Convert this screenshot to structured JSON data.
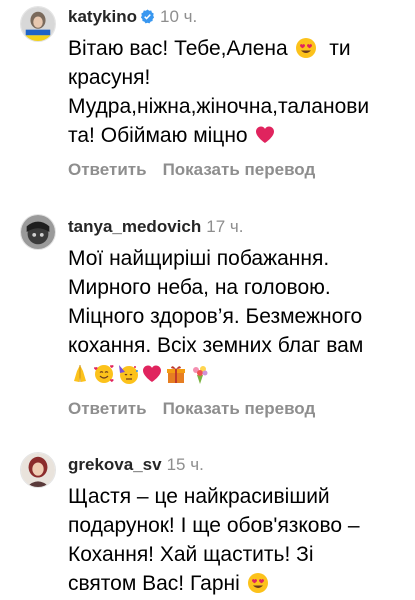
{
  "comments": [
    {
      "username": "katykino",
      "verified": true,
      "time": "10 ч.",
      "lines": [
        "Вітаю вас! Тебе,Алена",
        "красуня!",
        "Мудра,ніжна,жіночна,таланови",
        "та! Обіймаю міцно"
      ],
      "line1_tail": "ти",
      "reply_label": "Ответить",
      "translate_label": "Показать перевод"
    },
    {
      "username": "tanya_medovich",
      "verified": false,
      "time": "17 ч.",
      "lines": [
        "Мої найщиріші побажання.",
        "Мирного неба, на головою.",
        "Міцного здоров’я. Безмежного",
        "кохання. Всіх земних благ вам"
      ],
      "reply_label": "Ответить",
      "translate_label": "Показать перевод"
    },
    {
      "username": "grekova_sv",
      "verified": false,
      "time": "15 ч.",
      "lines": [
        "Щастя – це найкрасивіший",
        "подарунок! І ще обов'язково –",
        "Кохання! Хай щастить! Зі",
        "святом Вас! Гарні"
      ]
    }
  ],
  "icons": {
    "verified": "verified-badge-icon",
    "heart_eyes": "heart-eyes-emoji",
    "red_heart": "red-heart-emoji",
    "folded_hands": "folded-hands-emoji",
    "smiling_hearts": "smiling-face-with-hearts-emoji",
    "partying_face": "partying-face-emoji",
    "gift": "wrapped-gift-emoji",
    "bouquet": "bouquet-emoji"
  },
  "colors": {
    "username": "#262626",
    "secondary": "#8e8e8e",
    "verified": "#3897f0",
    "heart": "#e0245e"
  }
}
